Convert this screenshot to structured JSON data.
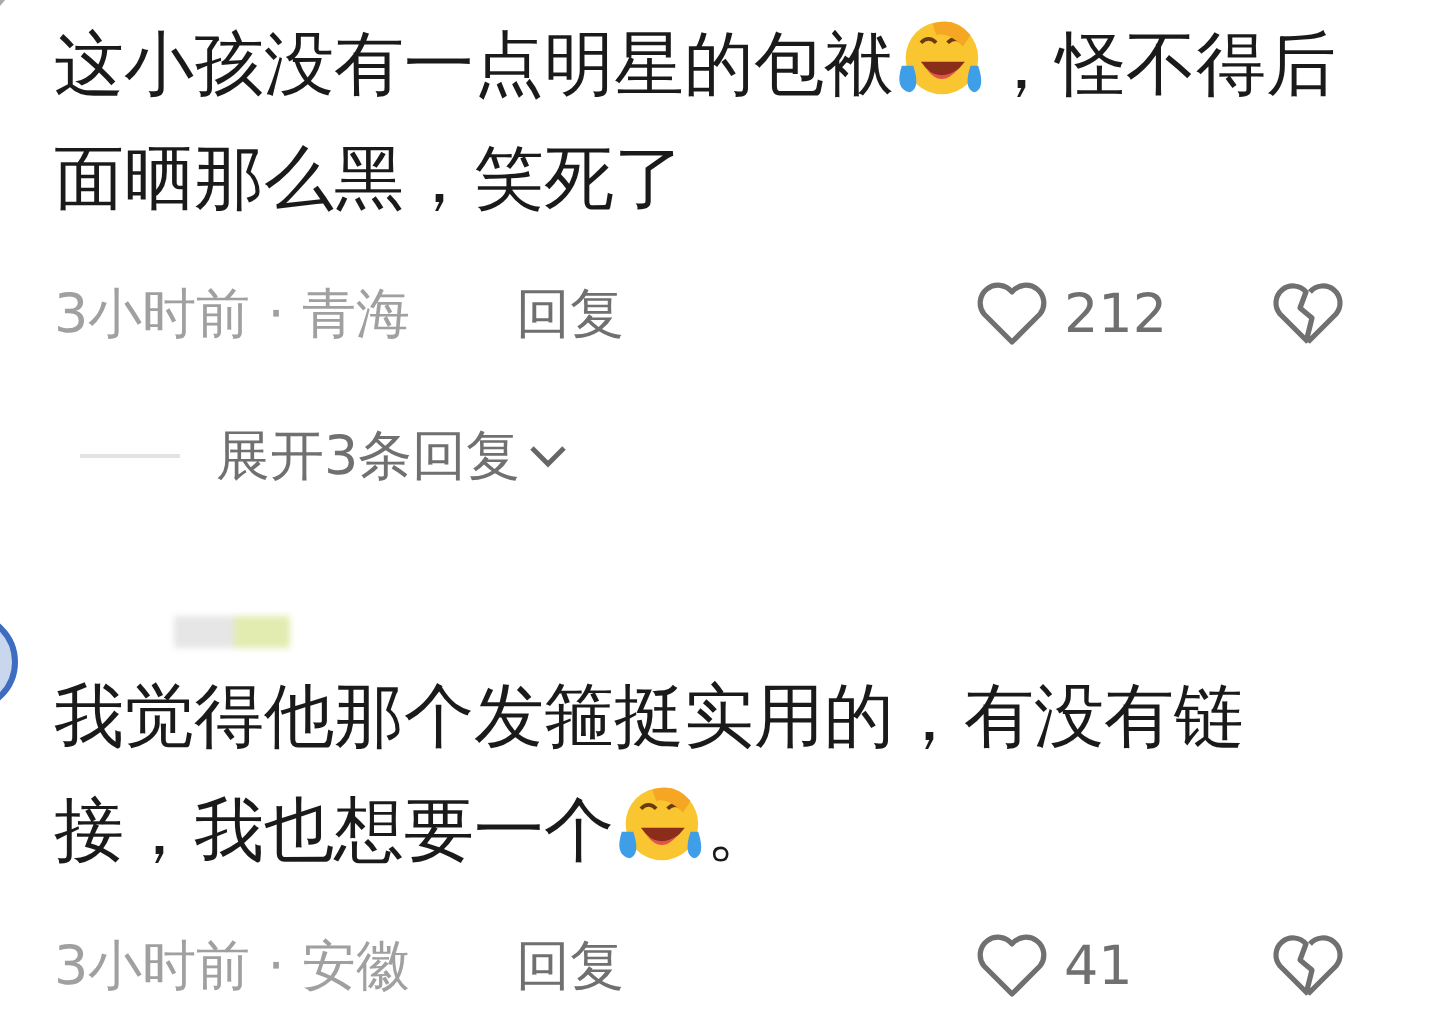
{
  "comments": [
    {
      "parts": [
        {
          "kind": "text",
          "text": "这小孩没有一点明星的包袱"
        },
        {
          "kind": "emoji"
        },
        {
          "kind": "text",
          "text": "，怪不得后面晒那么黑，笑死了"
        }
      ],
      "meta": "3小时前 · 青海",
      "reply": "回复",
      "likes": "212",
      "expand": "展开3条回复"
    },
    {
      "parts": [
        {
          "kind": "text",
          "text": "我觉得他那个发箍挺实用的，有没有链接，我也想要一个"
        },
        {
          "kind": "emoji"
        },
        {
          "kind": "text",
          "text": "。"
        }
      ],
      "meta": "3小时前 · 安徽",
      "reply": "回复",
      "likes": "41"
    }
  ]
}
